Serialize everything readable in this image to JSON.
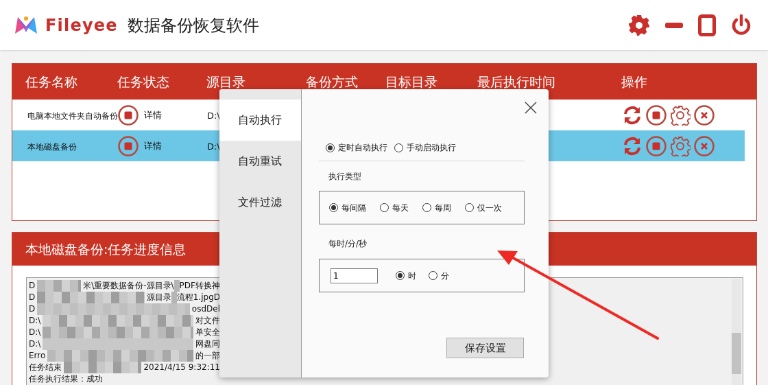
{
  "app": {
    "brand": "Fileyee",
    "title": "数据备份恢复软件"
  },
  "window_controls": [
    {
      "kind": "settings"
    },
    {
      "kind": "minimize"
    },
    {
      "kind": "maximize"
    },
    {
      "kind": "power"
    }
  ],
  "task_table": {
    "columns": [
      "任务名称",
      "任务状态",
      "源目录",
      "备份方式",
      "目标目录",
      "最后执行时间",
      "操作"
    ],
    "rows": [
      {
        "name": "电脑本地文件夹自动备份",
        "detail": "详情",
        "source": "D:\\",
        "selected": false
      },
      {
        "name": "本地磁盘备份",
        "detail": "详情",
        "source": "D:\\",
        "selected": true
      }
    ]
  },
  "progress_panel": {
    "title": "本地磁盘备份:任务进度信息",
    "log_lines": [
      {
        "left": "D",
        "right": [
          "米\\重要数据备份-源目录\\",
          "PDF转换神"
        ]
      },
      {
        "left": "D",
        "right": [
          "源目录",
          "流程1.jpgD"
        ]
      },
      {
        "left": "D",
        "right": [
          "osdDel"
        ]
      },
      {
        "left": "D:\\",
        "right": [
          "对文件"
        ]
      },
      {
        "left": "D:\\",
        "right": [
          "单安全"
        ]
      },
      {
        "left": "D:\\",
        "right": [
          "网盘同"
        ]
      },
      {
        "left": "Erro",
        "right": [
          "的一部"
        ]
      },
      {
        "left": "任务结束",
        "right": [
          "2021/4/15 9:32:11"
        ]
      },
      {
        "left": "任务执行结果：成功"
      }
    ]
  },
  "settings_dialog": {
    "tabs": [
      {
        "label": "自动执行",
        "selected": true
      },
      {
        "label": "自动重试",
        "selected": false
      },
      {
        "label": "文件过滤",
        "selected": false
      }
    ],
    "mode_options": [
      {
        "label": "定时自动执行",
        "selected": true
      },
      {
        "label": "手动启动执行",
        "selected": false
      }
    ],
    "type_label": "执行类型",
    "type_options": [
      {
        "label": "每间隔",
        "selected": true
      },
      {
        "label": "每天",
        "selected": false
      },
      {
        "label": "每周",
        "selected": false
      },
      {
        "label": "仅一次",
        "selected": false
      }
    ],
    "interval_label": "每时/分/秒",
    "interval_value": "1",
    "unit_options": [
      {
        "label": "时",
        "selected": true
      },
      {
        "label": "分",
        "selected": false
      }
    ],
    "save_button": "保存设置"
  }
}
